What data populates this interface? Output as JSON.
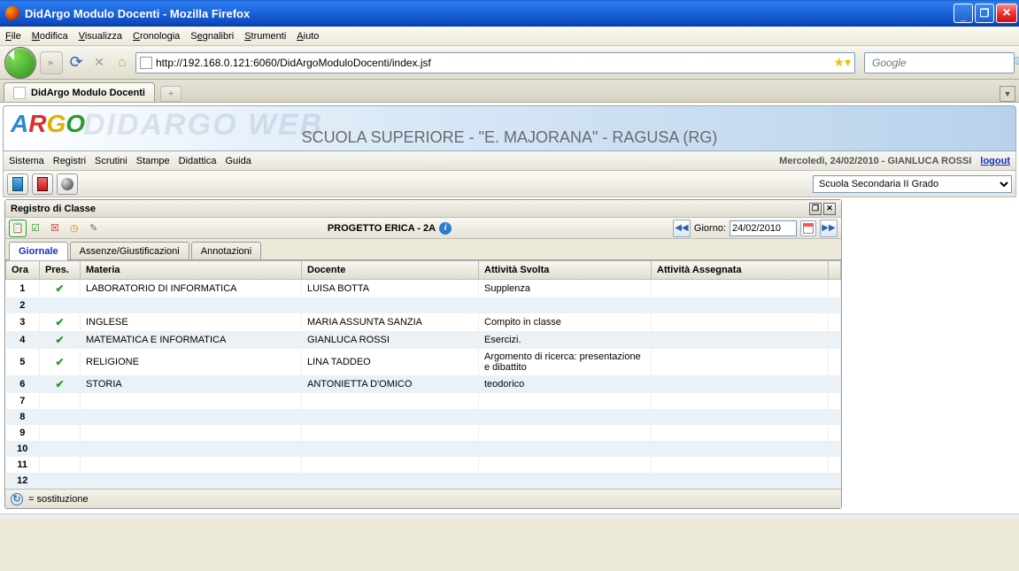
{
  "window": {
    "title": "DidArgo Modulo Docenti - Mozilla Firefox"
  },
  "browser": {
    "menu": [
      "File",
      "Modifica",
      "Visualizza",
      "Cronologia",
      "Segnalibri",
      "Strumenti",
      "Aiuto"
    ],
    "url": "http://192.168.0.121:6060/DidArgoModuloDocenti/index.jsf",
    "search_placeholder": "Google",
    "tab_title": "DidArgo Modulo Docenti"
  },
  "app": {
    "logo_text": "ARGO",
    "watermark": "DIDARGO WEB",
    "school": "SCUOLA SUPERIORE - \"E. MAJORANA\" - RAGUSA (RG)",
    "menu": [
      "Sistema",
      "Registri",
      "Scrutini",
      "Stampe",
      "Didattica",
      "Guida"
    ],
    "status_date": "Mercoledì, 24/02/2010 - GIANLUCA ROSSI",
    "logout_label": "logout",
    "school_select": "Scuola Secondaria II Grado"
  },
  "panel": {
    "title": "Registro di Classe",
    "class_title": "PROGETTO ERICA - 2A",
    "date_label": "Giorno:",
    "date_value": "24/02/2010",
    "tabs": [
      "Giornale",
      "Assenze/Giustificazioni",
      "Annotazioni"
    ],
    "columns": [
      "Ora",
      "Pres.",
      "Materia",
      "Docente",
      "Attività Svolta",
      "Attività Assegnata"
    ],
    "rows": [
      {
        "ora": "1",
        "pres": true,
        "materia": "LABORATORIO DI INFORMATICA",
        "docente": "LUISA BOTTA",
        "svolta": "Supplenza",
        "assegnata": ""
      },
      {
        "ora": "2",
        "pres": false,
        "materia": "",
        "docente": "",
        "svolta": "",
        "assegnata": ""
      },
      {
        "ora": "3",
        "pres": true,
        "materia": "INGLESE",
        "docente": "MARIA ASSUNTA SANZIA",
        "svolta": "Compito in classe",
        "assegnata": ""
      },
      {
        "ora": "4",
        "pres": true,
        "materia": "MATEMATICA E INFORMATICA",
        "docente": "GIANLUCA ROSSI",
        "svolta": "Esercizi.",
        "assegnata": ""
      },
      {
        "ora": "5",
        "pres": true,
        "materia": "RELIGIONE",
        "docente": "LINA TADDEO",
        "svolta": "Argomento di ricerca: presentazione e dibattito",
        "assegnata": ""
      },
      {
        "ora": "6",
        "pres": true,
        "materia": "STORIA",
        "docente": "ANTONIETTA D'OMICO",
        "svolta": "teodorico",
        "assegnata": ""
      },
      {
        "ora": "7",
        "pres": false,
        "materia": "",
        "docente": "",
        "svolta": "",
        "assegnata": ""
      },
      {
        "ora": "8",
        "pres": false,
        "materia": "",
        "docente": "",
        "svolta": "",
        "assegnata": ""
      },
      {
        "ora": "9",
        "pres": false,
        "materia": "",
        "docente": "",
        "svolta": "",
        "assegnata": ""
      },
      {
        "ora": "10",
        "pres": false,
        "materia": "",
        "docente": "",
        "svolta": "",
        "assegnata": ""
      },
      {
        "ora": "11",
        "pres": false,
        "materia": "",
        "docente": "",
        "svolta": "",
        "assegnata": ""
      },
      {
        "ora": "12",
        "pres": false,
        "materia": "",
        "docente": "",
        "svolta": "",
        "assegnata": ""
      }
    ],
    "footer_legend": "= sostituzione"
  }
}
